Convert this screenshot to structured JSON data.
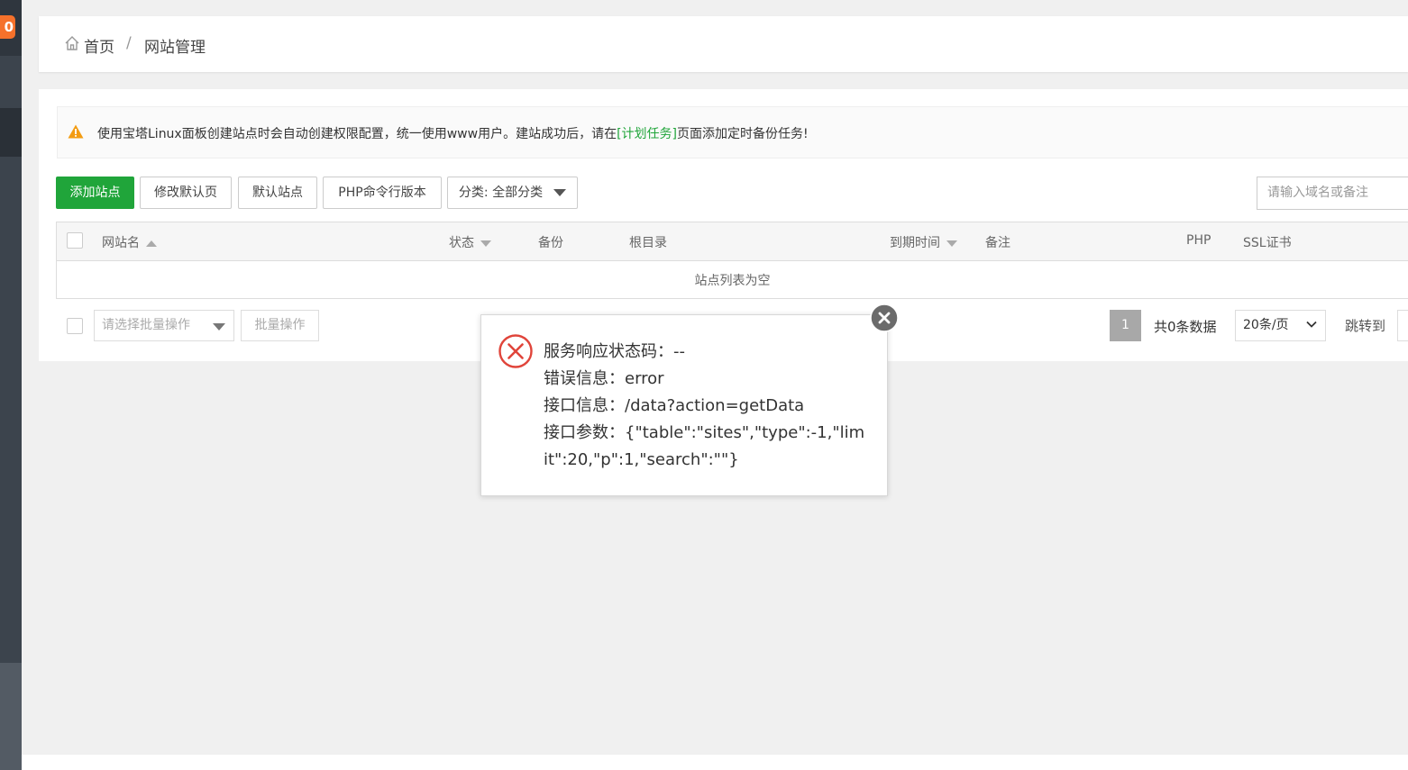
{
  "sidebar": {
    "badge": "0"
  },
  "breadcrumb": {
    "home": "首页",
    "separator": "/",
    "current": "网站管理"
  },
  "alert": {
    "text_before": "使用宝塔Linux面板创建站点时会自动创建权限配置，统一使用www用户。建站成功后，请在",
    "link": "[计划任务]",
    "text_after": "页面添加定时备份任务!"
  },
  "toolbar": {
    "add_site": "添加站点",
    "edit_default_page": "修改默认页",
    "default_site": "默认站点",
    "php_cli_version": "PHP命令行版本",
    "category": "分类: 全部分类",
    "search_placeholder": "请输入域名或备注"
  },
  "table": {
    "headers": [
      "网站名",
      "状态",
      "备份",
      "根目录",
      "到期时间",
      "备注",
      "PHP",
      "SSL证书"
    ],
    "empty_text": "站点列表为空"
  },
  "batch": {
    "select_placeholder": "请选择批量操作",
    "button": "批量操作"
  },
  "pagination": {
    "current_page": "1",
    "total": "共0条数据",
    "page_size": "20条/页",
    "jump_label": "跳转到"
  },
  "dialog": {
    "status_line": "服务响应状态码：--",
    "error_line": "错误信息：error",
    "api_line": "接口信息：/data?action=getData",
    "params_line": "接口参数：{\"table\":\"sites\",\"type\":-1,\"limit\":20,\"p\":1,\"search\":\"\"}"
  },
  "colors": {
    "accent_green": "#20a53a",
    "badge_orange": "#f5712b",
    "error_red": "#e0443a",
    "sidebar": "#3c444d"
  }
}
